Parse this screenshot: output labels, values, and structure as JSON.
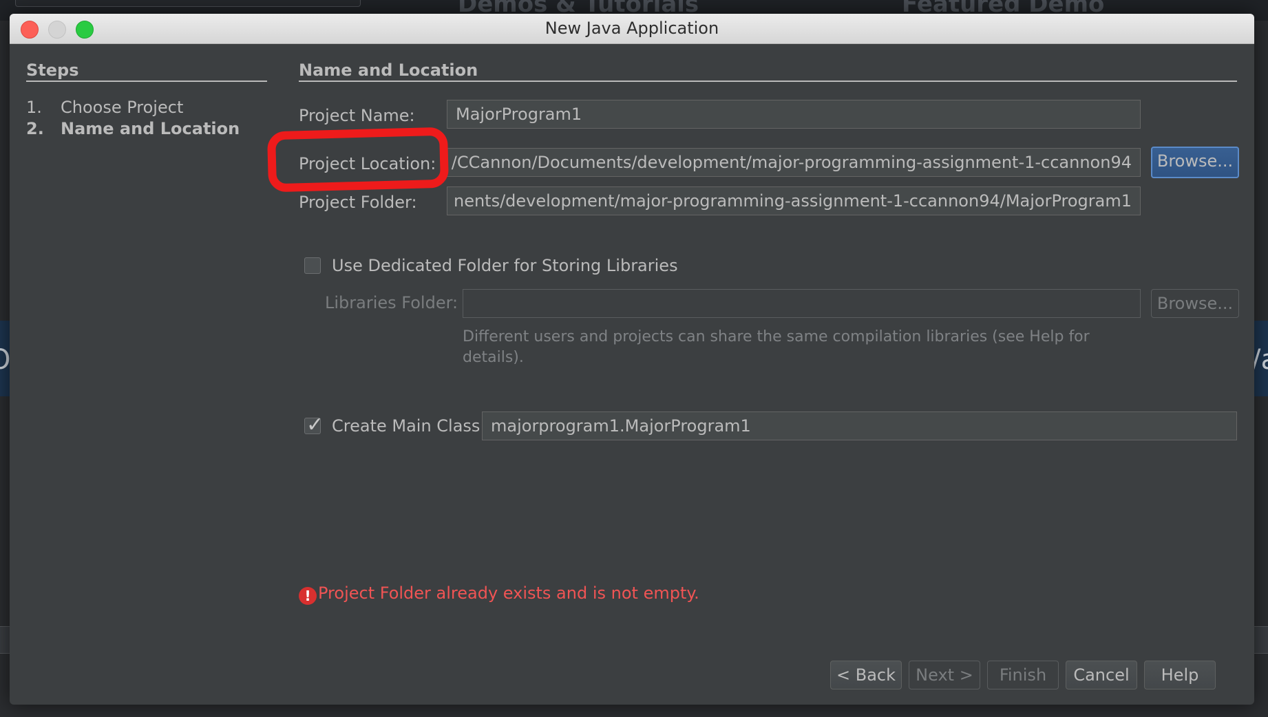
{
  "background": {
    "heading_left": "Demos & Tutorials",
    "heading_right": "Featured Demo",
    "band_left_text": "O",
    "band_right_text": "/a"
  },
  "window": {
    "title": "New Java Application"
  },
  "steps": {
    "title": "Steps",
    "items": [
      {
        "number": "1.",
        "label": "Choose Project",
        "active": false
      },
      {
        "number": "2.",
        "label": "Name and Location",
        "active": true
      }
    ]
  },
  "main": {
    "section_title": "Name and Location",
    "project_name": {
      "label": "Project Name:",
      "value": "MajorProgram1"
    },
    "project_location": {
      "label": "Project Location:",
      "value": "/CCannon/Documents/development/major-programming-assignment-1-ccannon94",
      "browse_label": "Browse..."
    },
    "project_folder": {
      "label": "Project Folder:",
      "value": "nents/development/major-programming-assignment-1-ccannon94/MajorProgram1"
    },
    "dedicated_folder": {
      "label": "Use Dedicated Folder for Storing Libraries",
      "checked": false
    },
    "libraries_folder": {
      "label": "Libraries Folder:",
      "value": "",
      "browse_label": "Browse...",
      "help_text": "Different users and projects can share the same compilation libraries (see Help for details)."
    },
    "main_class": {
      "label": "Create Main Class",
      "checked": true,
      "value": "majorprogram1.MajorProgram1"
    },
    "error_message": "Project Folder already exists and is not empty."
  },
  "footer": {
    "back_label": "< Back",
    "next_label": "Next >",
    "finish_label": "Finish",
    "cancel_label": "Cancel",
    "help_label": "Help"
  },
  "colors": {
    "dialog_bg": "#3c3f41",
    "error": "#f05454",
    "annotation": "#ee1b1b",
    "focus_button": "#385f91"
  }
}
